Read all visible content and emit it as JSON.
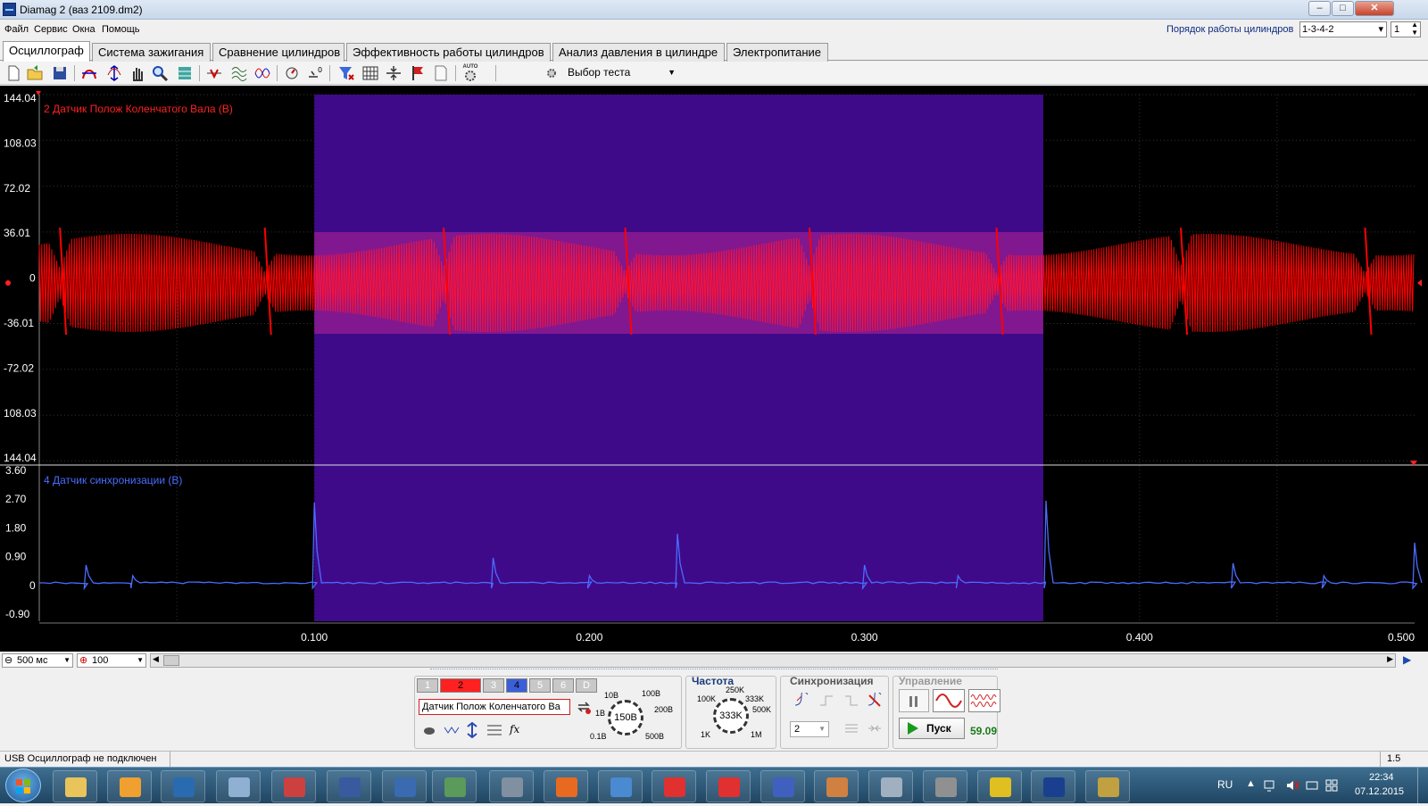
{
  "window": {
    "title": "Diamag 2 (ваз 2109.dm2)"
  },
  "menu": [
    "Файл",
    "Сервис",
    "Окна",
    "Помощь"
  ],
  "cylinder_order": {
    "label": "Порядок работы цилиндров",
    "value": "1-3-4-2",
    "count": "1"
  },
  "tabs": [
    "Осциллограф",
    "Система зажигания",
    "Сравнение цилиндров",
    "Эффективность работы цилиндров",
    "Анализ давления в цилиндре",
    "Электропитание"
  ],
  "active_tab": 0,
  "toolbar": {
    "test_select": "Выбор теста",
    "auto_label": "AUTO"
  },
  "scope": {
    "channel2": {
      "name": "2 Датчик Полож Коленчатого Вала (В)",
      "color": "#ff0000",
      "y_ticks": [
        "144.04",
        "108.03",
        "72.02",
        "36.01",
        "0",
        "-36.01",
        "-72.02",
        "108.03",
        "144.04"
      ]
    },
    "channel4": {
      "name": "4 Датчик синхронизации (В)",
      "color": "#4a6cff",
      "y_ticks": [
        "3.60",
        "2.70",
        "1.80",
        "0.90",
        "0",
        "-0.90"
      ]
    },
    "x_ticks": [
      "0.100",
      "0.200",
      "0.300",
      "0.400",
      "0.500"
    ],
    "selection_color": "#3f0a8a",
    "selection_x_range": [
      0.1,
      0.365
    ],
    "visible_x_range": [
      0.0,
      0.5
    ]
  },
  "hscroll": {
    "timebase": "500 мс",
    "zoom": "100"
  },
  "panel": {
    "channels": [
      "1",
      "2",
      "3",
      "4",
      "5",
      "6",
      "D"
    ],
    "active_channels": {
      "2": "#ff2020",
      "4": "#3a5fd9"
    },
    "sensor_select": "Датчик Полож Коленчатого Ва",
    "voltage": {
      "value": "150В",
      "labels": [
        "10В",
        "100В",
        "1В",
        "200В",
        "0.1В",
        "500В"
      ]
    },
    "frequency": {
      "title": "Частота",
      "value": "333K",
      "labels": [
        "250K",
        "100K",
        "333K",
        "500K",
        "1K",
        "1M"
      ]
    },
    "sync": {
      "title": "Синхронизация",
      "channel": "2"
    },
    "control": {
      "title": "Управление",
      "start": "Пуск",
      "fps": "59.09"
    }
  },
  "status": {
    "text": "USB Осциллограф не подключен",
    "right": "1.5"
  },
  "taskbar": {
    "lang": "RU",
    "time": "22:34",
    "date": "07.12.2015"
  }
}
